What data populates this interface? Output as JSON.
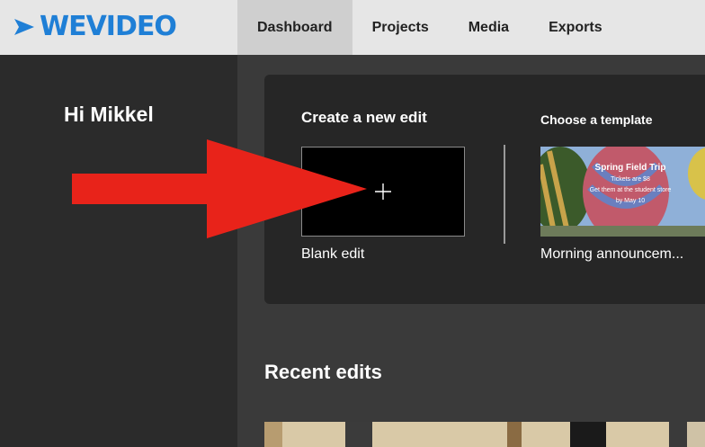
{
  "brand": {
    "logo_text": "WEVIDEO",
    "logo_color": "#1f7fd6"
  },
  "nav": {
    "items": [
      {
        "label": "Dashboard",
        "active": true
      },
      {
        "label": "Projects",
        "active": false
      },
      {
        "label": "Media",
        "active": false
      },
      {
        "label": "Exports",
        "active": false
      }
    ]
  },
  "sidebar": {
    "greeting": "Hi Mikkel"
  },
  "create": {
    "title": "Create a new edit",
    "blank_label": "Blank edit",
    "template_title": "Choose a template",
    "template_label": "Morning announcem...",
    "template_preview": {
      "heading": "Spring Field Trip",
      "line1": "Tickets are $8",
      "line2": "Get them at the student store",
      "line3": "by May 10"
    }
  },
  "recent": {
    "title": "Recent edits"
  },
  "colors": {
    "arrow": "#e8231a",
    "accent": "#1f7fd6"
  }
}
